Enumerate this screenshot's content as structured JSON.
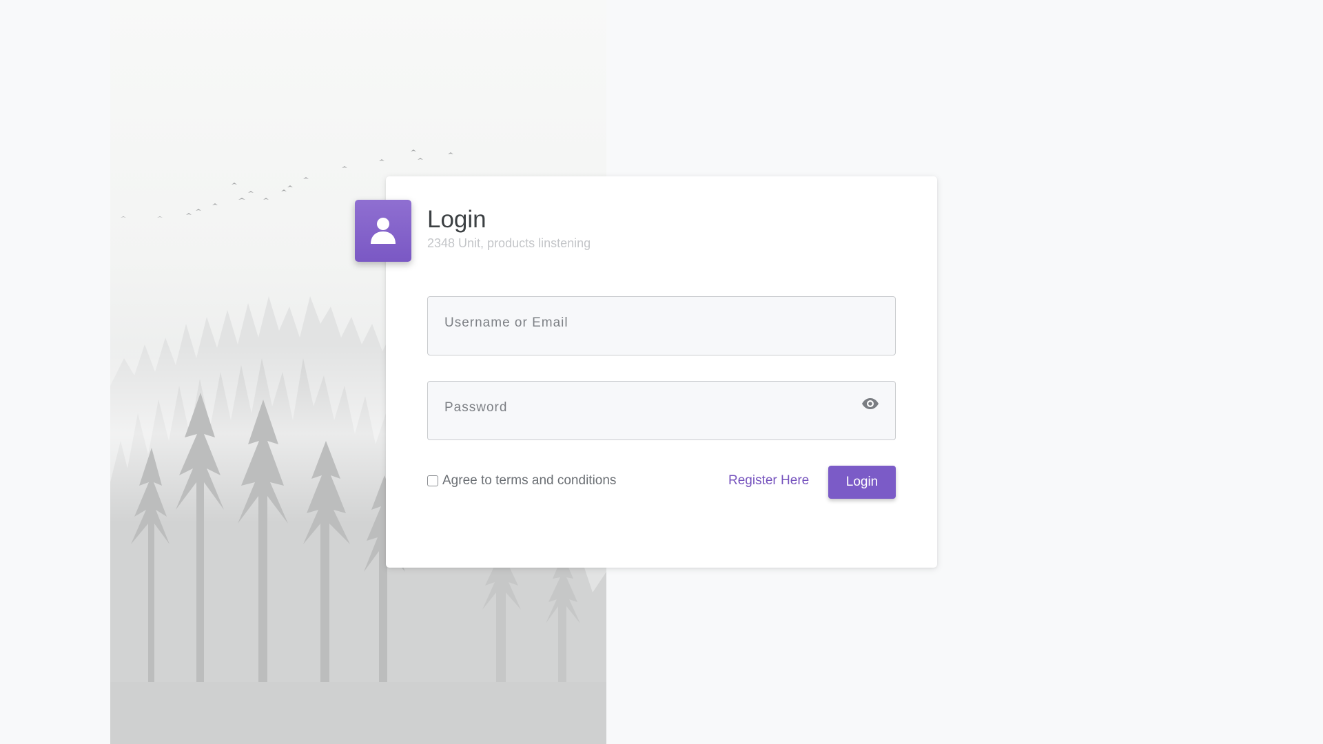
{
  "colors": {
    "accent": "#7b5bc7",
    "link": "#7552bd",
    "page_background": "#f8f9fa",
    "card_background": "#ffffff"
  },
  "login_card": {
    "title": "Login",
    "subtitle": "2348 Unit, products linstening",
    "avatar_icon": "user-icon"
  },
  "form": {
    "username": {
      "placeholder": "Username or Email",
      "value": ""
    },
    "password": {
      "placeholder": "Password",
      "value": "",
      "toggle_icon": "eye-icon"
    },
    "terms_label": "Agree to terms and conditions",
    "terms_checked": false,
    "register_link": "Register Here",
    "login_button": "Login"
  }
}
